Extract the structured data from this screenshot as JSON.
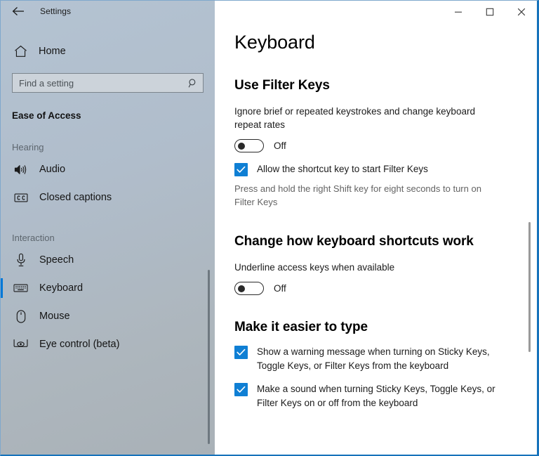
{
  "window": {
    "titlebar_app_name": "Settings",
    "back_icon": "back-arrow-icon",
    "minimize_label": "Minimize",
    "maximize_label": "Maximize",
    "close_label": "Close",
    "accent_color": "#0078d7",
    "border_color": "#1672bb"
  },
  "sidebar": {
    "home": {
      "label": "Home",
      "icon": "home-icon"
    },
    "search": {
      "placeholder": "Find a setting",
      "value": "",
      "icon": "search-icon"
    },
    "category_title": "Ease of Access",
    "groups": [
      {
        "label": "Hearing",
        "items": [
          {
            "label": "Audio",
            "icon": "speaker-icon",
            "selected": false
          },
          {
            "label": "Closed captions",
            "icon": "closed-caption-icon",
            "selected": false
          }
        ]
      },
      {
        "label": "Interaction",
        "items": [
          {
            "label": "Speech",
            "icon": "microphone-icon",
            "selected": false
          },
          {
            "label": "Keyboard",
            "icon": "keyboard-icon",
            "selected": true
          },
          {
            "label": "Mouse",
            "icon": "mouse-icon",
            "selected": false
          },
          {
            "label": "Eye control (beta)",
            "icon": "eye-control-icon",
            "selected": false
          }
        ]
      }
    ]
  },
  "main": {
    "page_title": "Keyboard",
    "sections": [
      {
        "heading": "Use Filter Keys",
        "description": "Ignore brief or repeated keystrokes and change keyboard repeat rates",
        "toggle": {
          "state_label": "Off",
          "checked": false
        },
        "checkbox": {
          "label": "Allow the shortcut key to start Filter Keys",
          "checked": true
        },
        "hint": "Press and hold the right Shift key for eight seconds to turn on Filter Keys"
      },
      {
        "heading": "Change how keyboard shortcuts work",
        "description": "Underline access keys when available",
        "toggle": {
          "state_label": "Off",
          "checked": false
        }
      },
      {
        "heading": "Make it easier to type",
        "checkboxes": [
          {
            "label": "Show a warning message when turning on Sticky Keys, Toggle Keys, or Filter Keys from the keyboard",
            "checked": true
          },
          {
            "label": "Make a sound when turning Sticky Keys, Toggle Keys, or Filter Keys on or off from the keyboard",
            "checked": true
          }
        ]
      }
    ]
  }
}
